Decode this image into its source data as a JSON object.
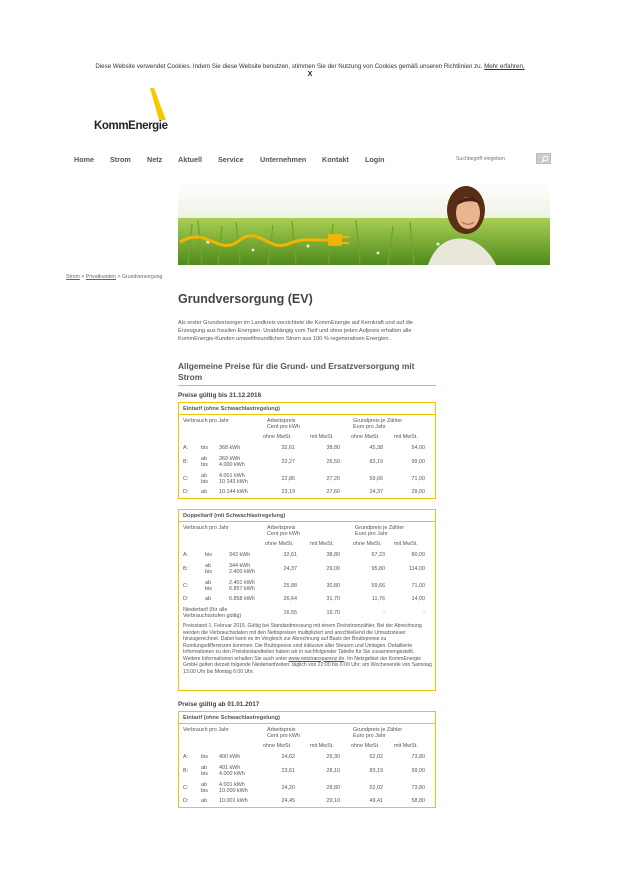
{
  "cookie": {
    "text": "Diese Website verwendet Cookies. Indem Sie diese Website benutzen, stimmen Sie der Nutzung von Cookies gemäß unseren Richtlinien zu.",
    "link": "Mehr erfahren.",
    "close": "X"
  },
  "logo": {
    "text": "KommEnergie",
    "accent": "#f5c800"
  },
  "nav": {
    "items": [
      "Home",
      "Strom",
      "Netz",
      "Aktuell",
      "Service",
      "Unternehmen",
      "Kontakt",
      "Login"
    ]
  },
  "search": {
    "placeholder": "Suchbegriff eingeben",
    "icon": "search-icon"
  },
  "breadcrumb": {
    "items": [
      "Strom",
      "Privatkunden",
      "Grundversorgung"
    ],
    "separator": ">"
  },
  "page": {
    "title": "Grundversorgung (EV)",
    "intro": "Als erster Grundversorger im Landkreis verzichtete die KommEnergie auf Kernkraft und auf die Erzeugung aus fossilen Energien. Unabhängig vom Tarif und ohne jeden Aufpreis erhalten alle KommEnergie-Kunden umweltfreundlichen Strom aus 100 % regenerativen Energien.",
    "heading": "Allgemeine Preise für die Grund- und Ersatzversorgung mit Strom"
  },
  "headers": {
    "verbrauch": "Verbrauch pro Jahr",
    "arbeitspreis_1": "Arbeitspreis",
    "arbeitspreis_2": "Cent pro kWh",
    "grundpreis_1": "Grundpreis je Zähler",
    "grundpreis_2": "Euro pro Jahr",
    "ohne": "ohne MwSt.",
    "mit": "mit MwSt."
  },
  "section1": {
    "valid": "Preise gültig bis 31.12.2016",
    "eintarif": {
      "title": "Eintarif (ohne Schwachlastregelung)",
      "rows": [
        {
          "label": "A:",
          "q1": "bis",
          "q2": "",
          "v1": "368 kWh",
          "v2": "",
          "ap_o": "32,61",
          "ap_m": "38,80",
          "gp_o": "45,38",
          "gp_m": "54,00"
        },
        {
          "label": "B:",
          "q1": "ab",
          "q2": "bis",
          "v1": "369 kWh",
          "v2": "4.000 kWh",
          "ap_o": "22,27",
          "ap_m": "26,50",
          "gp_o": "83,19",
          "gp_m": "99,00"
        },
        {
          "label": "C:",
          "q1": "ab",
          "q2": "bis",
          "v1": "4.001 kWh",
          "v2": "10.143 kWh",
          "ap_o": "22,86",
          "ap_m": "27,20",
          "gp_o": "59,66",
          "gp_m": "71,00"
        },
        {
          "label": "D:",
          "q1": "ab",
          "q2": "",
          "v1": "10.144 kWh",
          "v2": "",
          "ap_o": "23,19",
          "ap_m": "27,60",
          "gp_o": "24,37",
          "gp_m": "29,00"
        }
      ]
    },
    "doppeltarif": {
      "title": "Doppeltarif (mit Schwachlastregelung)",
      "rows": [
        {
          "label": "A:",
          "q1": "bis",
          "q2": "",
          "v1": "343 kWh",
          "v2": "",
          "ap_o": "32,61",
          "ap_m": "38,80",
          "gp_o": "67,23",
          "gp_m": "80,00"
        },
        {
          "label": "B:",
          "q1": "ab",
          "q2": "bis",
          "v1": "344 kWh",
          "v2": "2.400 kWh",
          "ap_o": "24,37",
          "ap_m": "29,00",
          "gp_o": "95,80",
          "gp_m": "114,00"
        },
        {
          "label": "C:",
          "q1": "ab",
          "q2": "bis",
          "v1": "2.401 kWh",
          "v2": "6.857 kWh",
          "ap_o": "25,88",
          "ap_m": "30,80",
          "gp_o": "59,66",
          "gp_m": "71,00"
        },
        {
          "label": "D:",
          "q1": "ab",
          "q2": "",
          "v1": "6.858 kWh",
          "v2": "",
          "ap_o": "26,64",
          "ap_m": "31,70",
          "gp_o": "11,76",
          "gp_m": "14,00"
        }
      ],
      "nt_label_1": "Niedertarif (für alle",
      "nt_label_2": "Verbrauchsstufen gültig)",
      "nt": {
        "ap_o": "16,55",
        "ap_m": "19,70",
        "gp_o": "-",
        "gp_m": "-"
      },
      "note_1": "Preisstand 1. Februar 2015. Gültig bei Standardmessung mit einem Drehstromzähler. Bei der Abrechnung werden die Verbrauchsdaten mit den Nettopreisen multipliziert und anschließend die Umsatzsteuer hinzugerechnet. Dabei kann es im Vergleich zur Abrechnung auf Basis der Bruttopreise zu Rundungsdifferenzen kommen. Die Bruttopreise sind inklusive aller Steuern und Umlagen. Detaillierte Informationen zu den Preisbestandteilen haben wir in nachfolgender Tabelle für Sie zusammengestellt. Weitere Informationen erhalten Sie auch unter",
      "note_link": "www.netztransparenz.de",
      "note_2": ". Im Netzgebiet der KommEnergie GmbH gelten derzeit folgende Niedertarifzeiten: täglich von 22:00 bis 6:00 Uhr; am Wochenende von Samstag 13:00 Uhr bis Montag 6:00 Uhr."
    }
  },
  "section2": {
    "valid": "Preise gültig ab 01.01.2017",
    "eintarif": {
      "title": "Eintarif (ohne Schwachlastregelung)",
      "rows": [
        {
          "label": "A:",
          "q1": "bis",
          "q2": "",
          "v1": "400 kWh",
          "v2": "",
          "ap_o": "24,62",
          "ap_m": "29,30",
          "gp_o": "62,02",
          "gp_m": "73,80"
        },
        {
          "label": "B:",
          "q1": "ab",
          "q2": "bis",
          "v1": "401 kWh",
          "v2": "4.000 kWh",
          "ap_o": "23,61",
          "ap_m": "28,10",
          "gp_o": "83,19",
          "gp_m": "99,00"
        },
        {
          "label": "C:",
          "q1": "ab",
          "q2": "bis",
          "v1": "4.001 kWh",
          "v2": "10.000 kWh",
          "ap_o": "24,20",
          "ap_m": "28,80",
          "gp_o": "52,02",
          "gp_m": "73,80"
        },
        {
          "label": "D:",
          "q1": "ab",
          "q2": "",
          "v1": "10.001 kWh",
          "v2": "",
          "ap_o": "24,45",
          "ap_m": "29,10",
          "gp_o": "49,41",
          "gp_m": "58,80"
        }
      ]
    }
  }
}
